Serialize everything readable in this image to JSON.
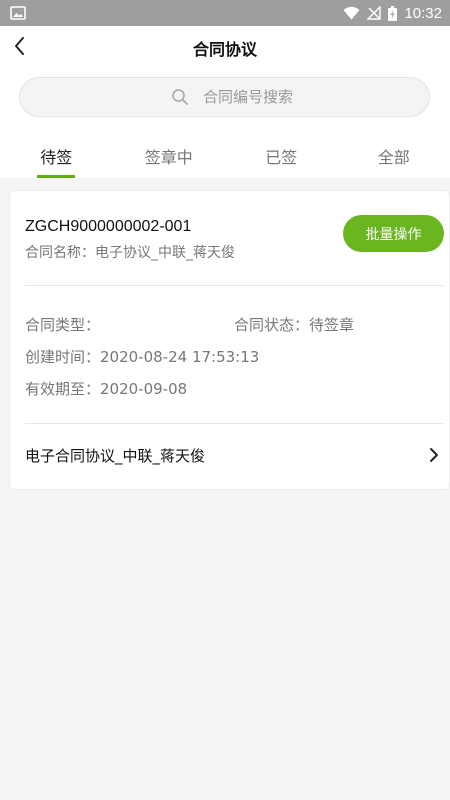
{
  "status_bar": {
    "time": "10:32"
  },
  "header": {
    "title": "合同协议"
  },
  "search": {
    "placeholder": "合同编号搜索"
  },
  "tabs": [
    {
      "label": "待签",
      "active": true
    },
    {
      "label": "签章中",
      "active": false
    },
    {
      "label": "已签",
      "active": false
    },
    {
      "label": "全部",
      "active": false
    }
  ],
  "card": {
    "contract_no": "ZGCH9000000002-001",
    "contract_name": "合同名称：电子协议_中联_蒋天俊",
    "batch_button": "批量操作",
    "type_label": "合同类型：",
    "status_label": "合同状态：待签章",
    "created": "创建时间：2020-08-24 17:53:13",
    "expires": "有效期至：2020-09-08",
    "link_label": "电子合同协议_中联_蒋天俊"
  },
  "colors": {
    "accent": "#6ab520",
    "status_bar": "#9e9e9e"
  }
}
